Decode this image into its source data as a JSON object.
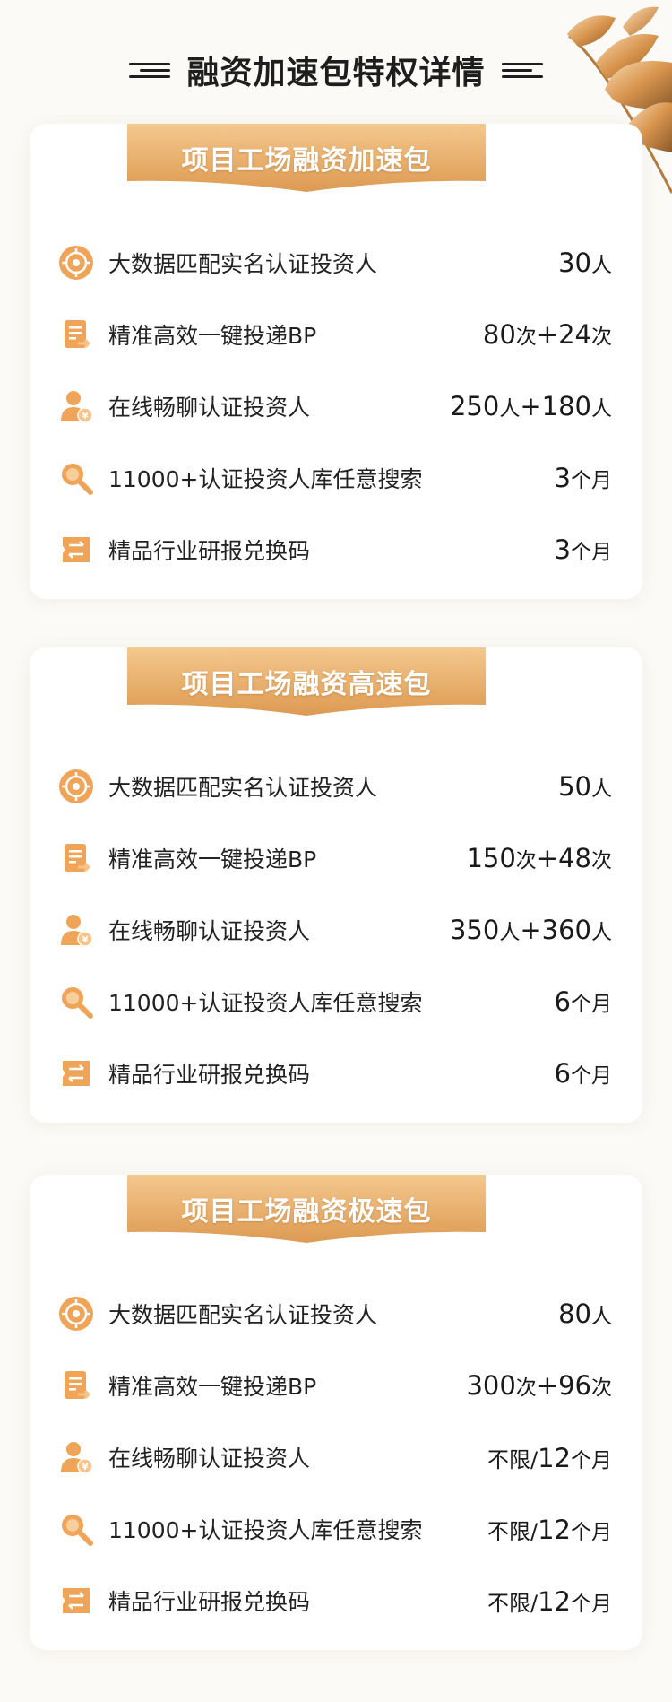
{
  "header": {
    "title": "融资加速包特权详情"
  },
  "packages": [
    {
      "name": "项目工场融资加速包",
      "items": [
        {
          "label": "大数据匹配实名认证投资人",
          "icon": "target-icon",
          "value_parts": [
            {
              "t": "30",
              "k": "num"
            },
            {
              "t": "人",
              "k": "unit"
            }
          ]
        },
        {
          "label": "精准高效一键投递BP",
          "icon": "document-send-icon",
          "value_parts": [
            {
              "t": "80",
              "k": "num"
            },
            {
              "t": "次",
              "k": "unit"
            },
            {
              "t": "+24",
              "k": "num"
            },
            {
              "t": "次",
              "k": "unit"
            }
          ]
        },
        {
          "label": "在线畅聊认证投资人",
          "icon": "investor-yen-icon",
          "value_parts": [
            {
              "t": "250",
              "k": "num"
            },
            {
              "t": "人",
              "k": "unit"
            },
            {
              "t": "+180",
              "k": "num"
            },
            {
              "t": "人",
              "k": "unit"
            }
          ]
        },
        {
          "label": "11000+认证投资人库任意搜索",
          "icon": "magnifier-icon",
          "value_parts": [
            {
              "t": "3",
              "k": "num"
            },
            {
              "t": "个月",
              "k": "unit"
            }
          ]
        },
        {
          "label": "精品行业研报兑换码",
          "icon": "exchange-ticket-icon",
          "value_parts": [
            {
              "t": "3",
              "k": "num"
            },
            {
              "t": "个月",
              "k": "unit"
            }
          ]
        }
      ]
    },
    {
      "name": "项目工场融资高速包",
      "items": [
        {
          "label": "大数据匹配实名认证投资人",
          "icon": "target-icon",
          "value_parts": [
            {
              "t": "50",
              "k": "num"
            },
            {
              "t": "人",
              "k": "unit"
            }
          ]
        },
        {
          "label": "精准高效一键投递BP",
          "icon": "document-send-icon",
          "value_parts": [
            {
              "t": "150",
              "k": "num"
            },
            {
              "t": "次",
              "k": "unit"
            },
            {
              "t": "+48",
              "k": "num"
            },
            {
              "t": "次",
              "k": "unit"
            }
          ]
        },
        {
          "label": "在线畅聊认证投资人",
          "icon": "investor-yen-icon",
          "value_parts": [
            {
              "t": "350",
              "k": "num"
            },
            {
              "t": "人",
              "k": "unit"
            },
            {
              "t": "+360",
              "k": "num"
            },
            {
              "t": "人",
              "k": "unit"
            }
          ]
        },
        {
          "label": "11000+认证投资人库任意搜索",
          "icon": "magnifier-icon",
          "value_parts": [
            {
              "t": "6",
              "k": "num"
            },
            {
              "t": "个月",
              "k": "unit"
            }
          ]
        },
        {
          "label": "精品行业研报兑换码",
          "icon": "exchange-ticket-icon",
          "value_parts": [
            {
              "t": "6",
              "k": "num"
            },
            {
              "t": "个月",
              "k": "unit"
            }
          ]
        }
      ]
    },
    {
      "name": "项目工场融资极速包",
      "items": [
        {
          "label": "大数据匹配实名认证投资人",
          "icon": "target-icon",
          "value_parts": [
            {
              "t": "80",
              "k": "num"
            },
            {
              "t": "人",
              "k": "unit"
            }
          ]
        },
        {
          "label": "精准高效一键投递BP",
          "icon": "document-send-icon",
          "value_parts": [
            {
              "t": "300",
              "k": "num"
            },
            {
              "t": "次",
              "k": "unit"
            },
            {
              "t": "+96",
              "k": "num"
            },
            {
              "t": "次",
              "k": "unit"
            }
          ]
        },
        {
          "label": "在线畅聊认证投资人",
          "icon": "investor-yen-icon",
          "value_parts": [
            {
              "t": "不限/",
              "k": "txt"
            },
            {
              "t": "12",
              "k": "num"
            },
            {
              "t": "个月",
              "k": "unit"
            }
          ]
        },
        {
          "label": "11000+认证投资人库任意搜索",
          "icon": "magnifier-icon",
          "value_parts": [
            {
              "t": "不限/",
              "k": "txt"
            },
            {
              "t": "12",
              "k": "num"
            },
            {
              "t": "个月",
              "k": "unit"
            }
          ]
        },
        {
          "label": "精品行业研报兑换码",
          "icon": "exchange-ticket-icon",
          "value_parts": [
            {
              "t": "不限/",
              "k": "txt"
            },
            {
              "t": "12",
              "k": "num"
            },
            {
              "t": "个月",
              "k": "unit"
            }
          ]
        }
      ]
    }
  ],
  "colors": {
    "gold_light": "#f4c88e",
    "gold_dark": "#dd9a52",
    "icon_orange": "#f0a458"
  }
}
